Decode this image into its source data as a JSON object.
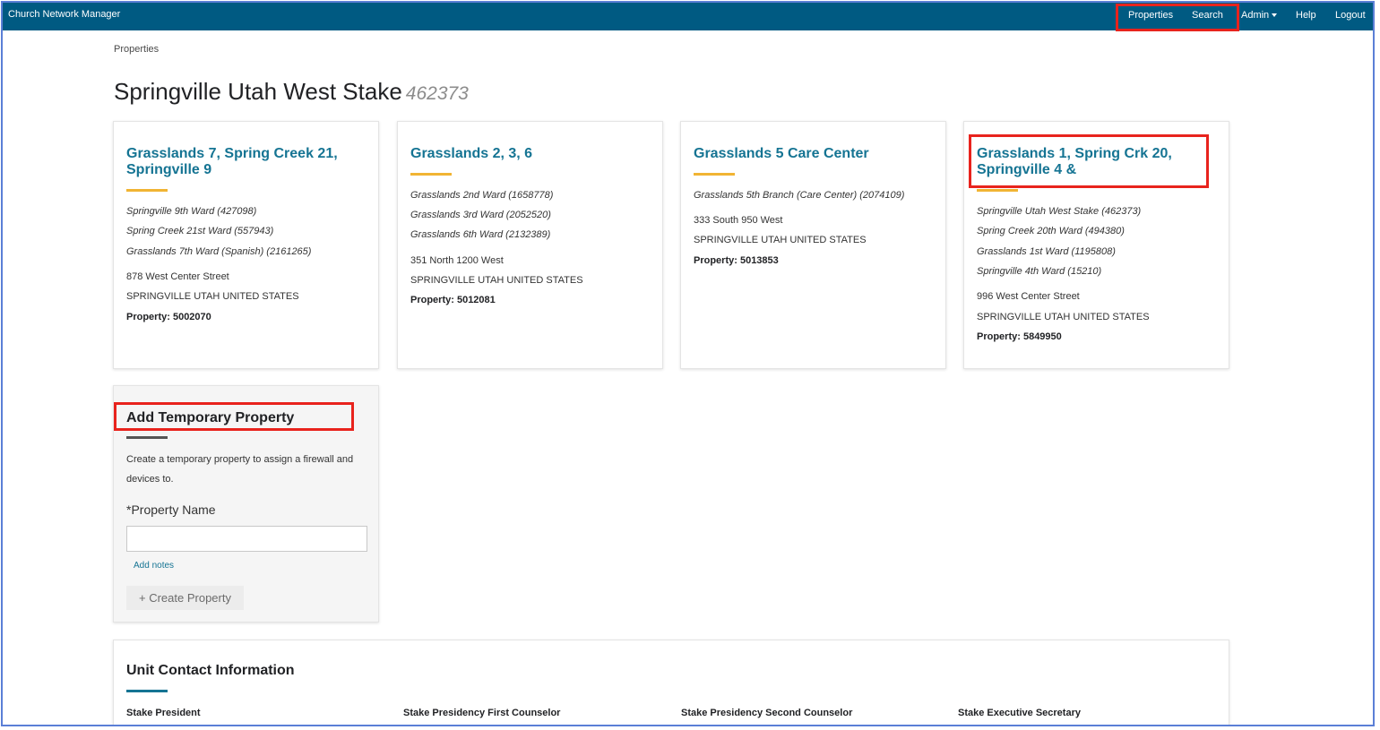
{
  "app": {
    "title": "Church Network Manager"
  },
  "nav": {
    "properties": "Properties",
    "search": "Search",
    "admin": "Admin",
    "help": "Help",
    "logout": "Logout"
  },
  "breadcrumb": "Properties",
  "page": {
    "title": "Springville Utah West Stake",
    "number": "462373"
  },
  "cards": [
    {
      "title": "Grasslands 7, Spring Creek 21, Springville 9",
      "wards": [
        "Springville 9th Ward (427098)",
        "Spring Creek 21st Ward (557943)",
        "Grasslands 7th Ward (Spanish) (2161265)"
      ],
      "street": "878 West Center Street",
      "city": "SPRINGVILLE UTAH UNITED STATES",
      "property": "Property: 5002070"
    },
    {
      "title": "Grasslands 2, 3, 6",
      "wards": [
        "Grasslands 2nd Ward (1658778)",
        "Grasslands 3rd Ward (2052520)",
        "Grasslands 6th Ward (2132389)"
      ],
      "street": "351 North 1200 West",
      "city": "SPRINGVILLE UTAH UNITED STATES",
      "property": "Property: 5012081"
    },
    {
      "title": "Grasslands 5 Care Center",
      "wards": [
        "Grasslands 5th Branch (Care Center) (2074109)"
      ],
      "street": "333 South 950 West",
      "city": "SPRINGVILLE UTAH UNITED STATES",
      "property": "Property: 5013853"
    },
    {
      "title": "Grasslands 1, Spring Crk 20, Springville 4 &",
      "wards": [
        "Springville Utah West Stake (462373)",
        "Spring Creek 20th Ward (494380)",
        "Grasslands 1st Ward (1195808)",
        "Springville 4th Ward (15210)"
      ],
      "street": "996 West Center Street",
      "city": "SPRINGVILLE UTAH UNITED STATES",
      "property": "Property: 5849950"
    }
  ],
  "add_property": {
    "title": "Add Temporary Property",
    "description": "Create a temporary property to assign a firewall and devices to.",
    "field_label": "*Property Name",
    "field_value": "",
    "add_notes": "Add notes",
    "create_button": "+ Create Property"
  },
  "contacts": {
    "title": "Unit Contact Information",
    "columns": [
      "Stake President",
      "Stake Presidency First Counselor",
      "Stake Presidency Second Counselor",
      "Stake Executive Secretary"
    ]
  },
  "colors": {
    "header": "#005a82",
    "link": "#157493",
    "accent": "#f1b433",
    "highlight": "#e8231d"
  }
}
